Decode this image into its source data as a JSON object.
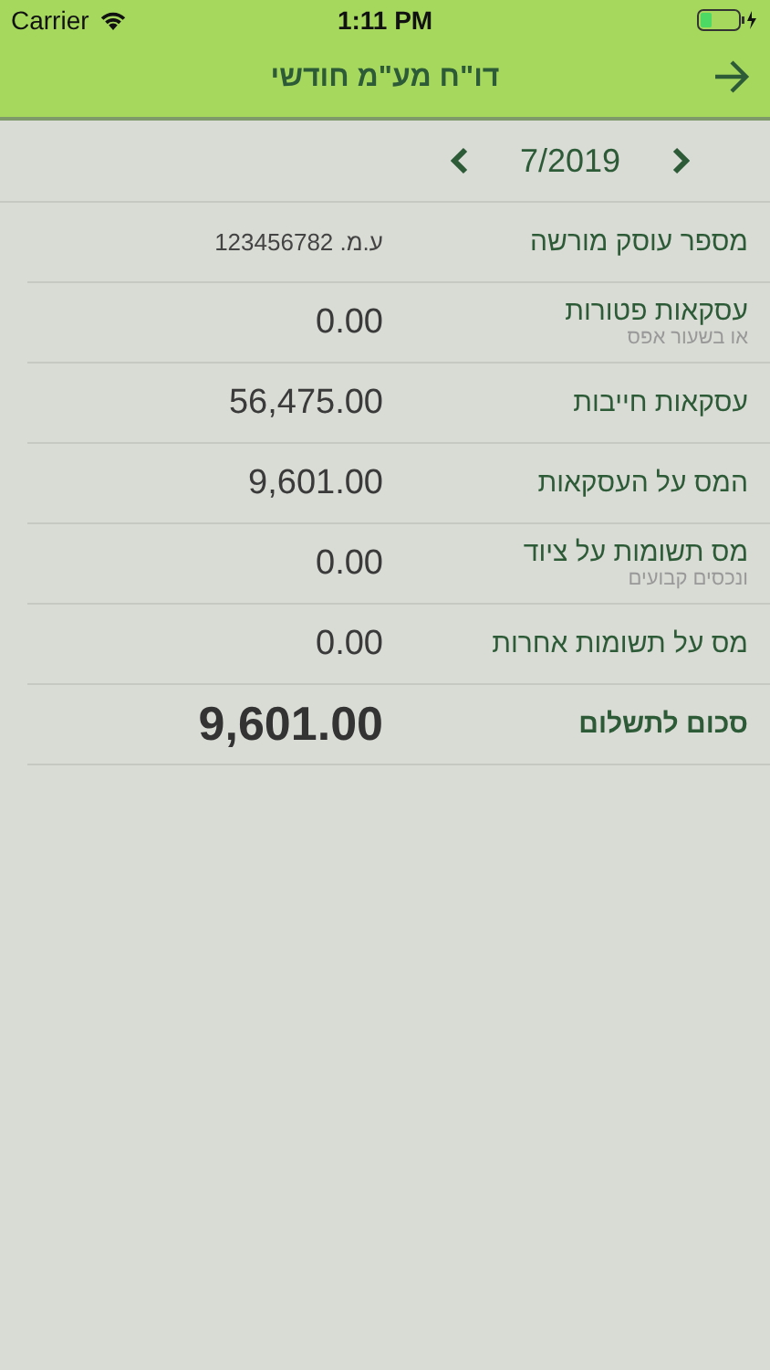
{
  "status_bar": {
    "carrier": "Carrier",
    "time": "1:11 PM"
  },
  "nav": {
    "title": "דו\"ח מע\"מ חודשי"
  },
  "period": {
    "label": "7/2019"
  },
  "rows": [
    {
      "kind": "id",
      "label": "מספר עוסק מורשה",
      "value": "ע.מ. 123456782"
    },
    {
      "kind": "amount",
      "label": "עסקאות פטורות",
      "sublabel": "או בשעור אפס",
      "value": "0.00"
    },
    {
      "kind": "amount",
      "label": "עסקאות חייבות",
      "value": "56,475.00"
    },
    {
      "kind": "amount",
      "label": "המס על העסקאות",
      "value": "9,601.00"
    },
    {
      "kind": "amount",
      "label": "מס תשומות על ציוד",
      "sublabel": "ונכסים קבועים",
      "value": "0.00"
    },
    {
      "kind": "amount",
      "label": "מס על תשומות אחרות",
      "value": "0.00"
    },
    {
      "kind": "total",
      "label": "סכום לתשלום",
      "value": "9,601.00"
    }
  ]
}
